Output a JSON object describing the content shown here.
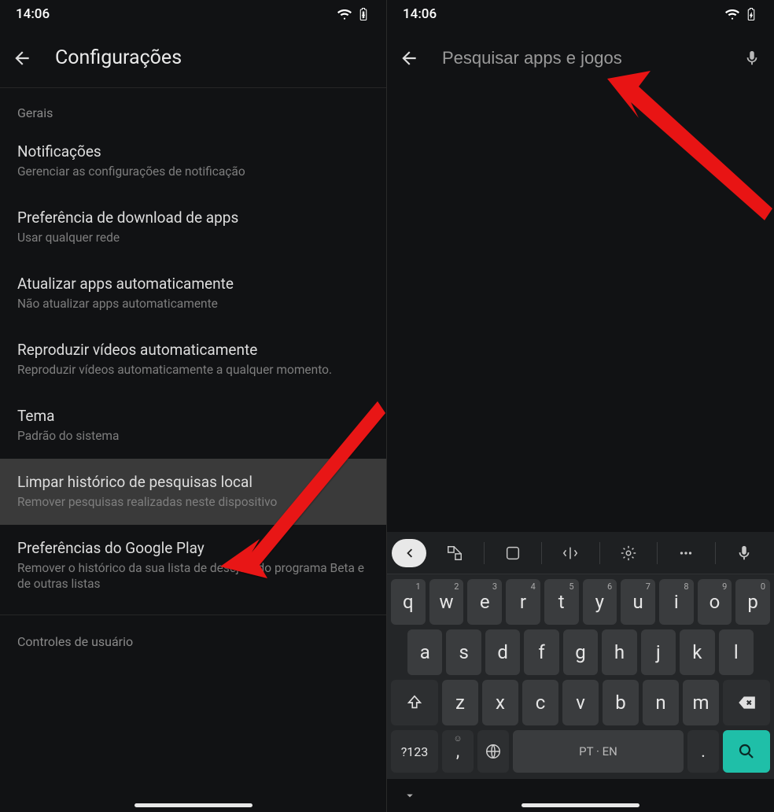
{
  "status": {
    "time": "14:06"
  },
  "left": {
    "title": "Configurações",
    "section1": "Gerais",
    "items": [
      {
        "title": "Notificações",
        "sub": "Gerenciar as configurações de notificação"
      },
      {
        "title": "Preferência de download de apps",
        "sub": "Usar qualquer rede"
      },
      {
        "title": "Atualizar apps automaticamente",
        "sub": "Não atualizar apps automaticamente"
      },
      {
        "title": "Reproduzir vídeos automaticamente",
        "sub": "Reproduzir vídeos automaticamente a qualquer momento."
      },
      {
        "title": "Tema",
        "sub": "Padrão do sistema"
      },
      {
        "title": "Limpar histórico de pesquisas local",
        "sub": "Remover pesquisas realizadas neste dispositivo"
      },
      {
        "title": "Preferências do Google Play",
        "sub": "Remover o histórico da sua lista de desejos, do programa Beta e de outras listas"
      }
    ],
    "section2": "Controles de usuário"
  },
  "right": {
    "search_placeholder": "Pesquisar apps e jogos"
  },
  "keyboard": {
    "row1": [
      "q",
      "w",
      "e",
      "r",
      "t",
      "y",
      "u",
      "i",
      "o",
      "p"
    ],
    "hints1": [
      "1",
      "2",
      "3",
      "4",
      "5",
      "6",
      "7",
      "8",
      "9",
      "0"
    ],
    "row2": [
      "a",
      "s",
      "d",
      "f",
      "g",
      "h",
      "j",
      "k",
      "l"
    ],
    "row3": [
      "z",
      "x",
      "c",
      "v",
      "b",
      "n",
      "m"
    ],
    "sym": "?123",
    "space": "PT · EN"
  }
}
